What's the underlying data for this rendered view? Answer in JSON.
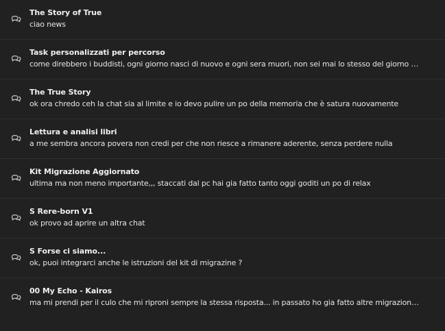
{
  "chats": [
    {
      "title": "The Story of True",
      "preview": "ciao news",
      "icon": "chat-bubbles-icon"
    },
    {
      "title": "Task personalizzati per percorso",
      "preview": "come direbbero i buddisti, ogni giorno nasci di nuovo e ogni sera muori, non sei mai lo stesso del giorno prima",
      "icon": "chat-bubbles-icon"
    },
    {
      "title": "The True Story",
      "preview": "ok ora chredo ceh la chat sia al limite e io devo pulire un po della memoria che è satura nuovamente",
      "icon": "chat-bubbles-icon"
    },
    {
      "title": "Lettura e analisi libri",
      "preview": "a me sembra ancora povera non credi per che non riesce a rimanere aderente, senza perdere nulla",
      "icon": "chat-bubbles-icon"
    },
    {
      "title": "Kit Migrazione Aggiornato",
      "preview": "ultima ma non meno importante,,, staccati dal pc hai gia fatto tanto oggi goditi un po di relax",
      "icon": "chat-bubbles-icon"
    },
    {
      "title": "S Rere-born V1",
      "preview": "ok provo ad aprire un altra chat",
      "icon": "chat-bubbles-icon"
    },
    {
      "title": "S Forse ci siamo...",
      "preview": "ok, puoi integrarci anche le istruzioni del kit di migrazine ?",
      "icon": "chat-bubbles-icon"
    },
    {
      "title": "00 My Echo - Kairos",
      "preview": "ma mi prendi per il culo che mi riproni sempre la stessa risposta... in passato ho gia fatto altre migrazioni e l'AI e...",
      "icon": "chat-bubbles-icon"
    }
  ]
}
